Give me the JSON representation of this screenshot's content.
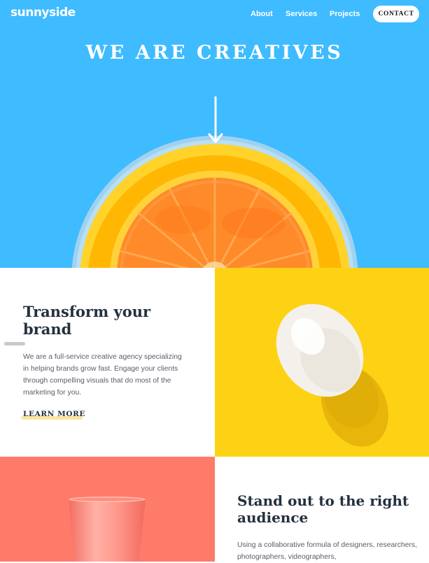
{
  "header": {
    "logo": "sunnyside",
    "nav": {
      "about": "About",
      "services": "Services",
      "projects": "Projects",
      "contact": "CONTACT"
    }
  },
  "hero": {
    "title": "WE ARE CREATIVES"
  },
  "transform": {
    "heading": "Transform your brand",
    "body": "We are a full-service creative agency specializing in helping brands grow fast. Engage your clients through compelling visuals that do most of the marketing for you.",
    "link": "LEARN MORE"
  },
  "standout": {
    "heading": "Stand out to the right audience",
    "body": "Using a collaborative formula of designers, researchers, photographers, videographers,"
  },
  "colors": {
    "hero_bg": "#3fbbff",
    "egg_bg": "#fed214",
    "cup_bg": "#fe7b69",
    "heading_text": "#24303f",
    "body_text": "#5a5d68"
  },
  "icons": {
    "hero_arrow": "arrow-down-icon"
  }
}
